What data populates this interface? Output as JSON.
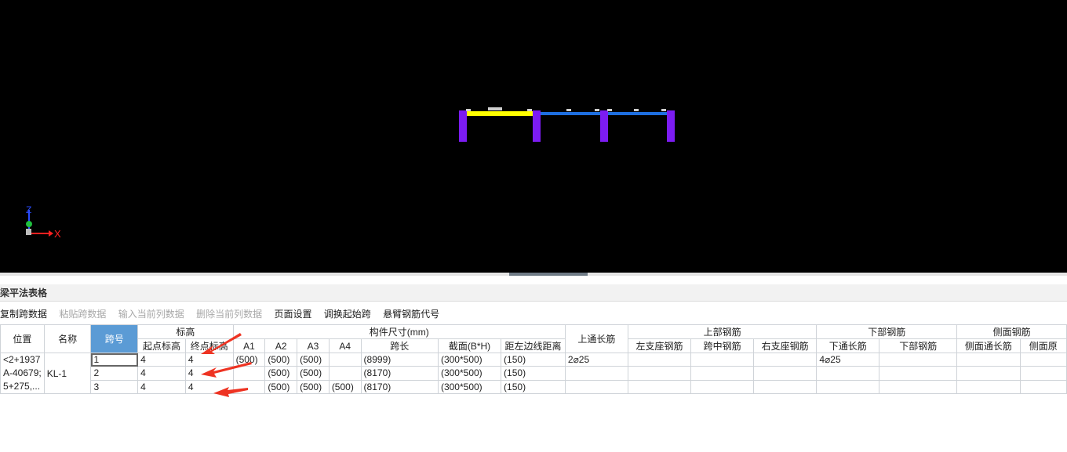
{
  "viewport": {
    "axis_x": "X",
    "axis_z": "Z",
    "colors": {
      "beam_selected": "#ffff00",
      "beam": "#1e6fe0",
      "column": "#7c1cf2",
      "background": "#000000"
    }
  },
  "panel": {
    "title": "梁平法表格"
  },
  "toolbar": {
    "copy": "复制跨数据",
    "paste": "粘贴跨数据",
    "input_col": "输入当前列数据",
    "delete_col": "删除当前列数据",
    "page_setup": "页面设置",
    "swap_start": "调换起始跨",
    "cantilever_code": "悬臂钢筋代号"
  },
  "table": {
    "headers": {
      "position": "位置",
      "name": "名称",
      "span": "跨号",
      "elevation": "标高",
      "start_elev": "起点标高",
      "end_elev": "终点标高",
      "dims": "构件尺寸(mm)",
      "a1": "A1",
      "a2": "A2",
      "a3": "A3",
      "a4": "A4",
      "span_len": "跨长",
      "section": "截面(B*H)",
      "edge_dist": "距左边线距离",
      "top_through": "上通长筋",
      "top_rebar": "上部钢筋",
      "left_support": "左支座钢筋",
      "mid_span": "跨中钢筋",
      "right_support": "右支座钢筋",
      "bottom_rebar": "下部钢筋",
      "bottom_through": "下通长筋",
      "bottom_rebar_sub": "下部钢筋",
      "side_rebar": "侧面钢筋",
      "side_through": "侧面通长筋",
      "side_orig": "侧面原"
    },
    "position": {
      "line1": "<2+1937",
      "line2": "A-40679;",
      "line3": "5+275,..."
    },
    "name": "KL-1",
    "rows": [
      {
        "span": "1",
        "start": "4",
        "end": "4",
        "a1": "(500)",
        "a2": "(500)",
        "a3": "(500)",
        "a4": "",
        "len": "(8999)",
        "section": "(300*500)",
        "edge": "(150)",
        "top_through": "2⌀25",
        "bottom_through": "4⌀25"
      },
      {
        "span": "2",
        "start": "4",
        "end": "4",
        "a1": "",
        "a2": "(500)",
        "a3": "(500)",
        "a4": "",
        "len": "(8170)",
        "section": "(300*500)",
        "edge": "(150)",
        "top_through": "",
        "bottom_through": ""
      },
      {
        "span": "3",
        "start": "4",
        "end": "4",
        "a1": "",
        "a2": "(500)",
        "a3": "(500)",
        "a4": "(500)",
        "len": "(8170)",
        "section": "(300*500)",
        "edge": "(150)",
        "top_through": "",
        "bottom_through": ""
      }
    ]
  },
  "annotations": {
    "arrow_color": "#ee3322"
  }
}
